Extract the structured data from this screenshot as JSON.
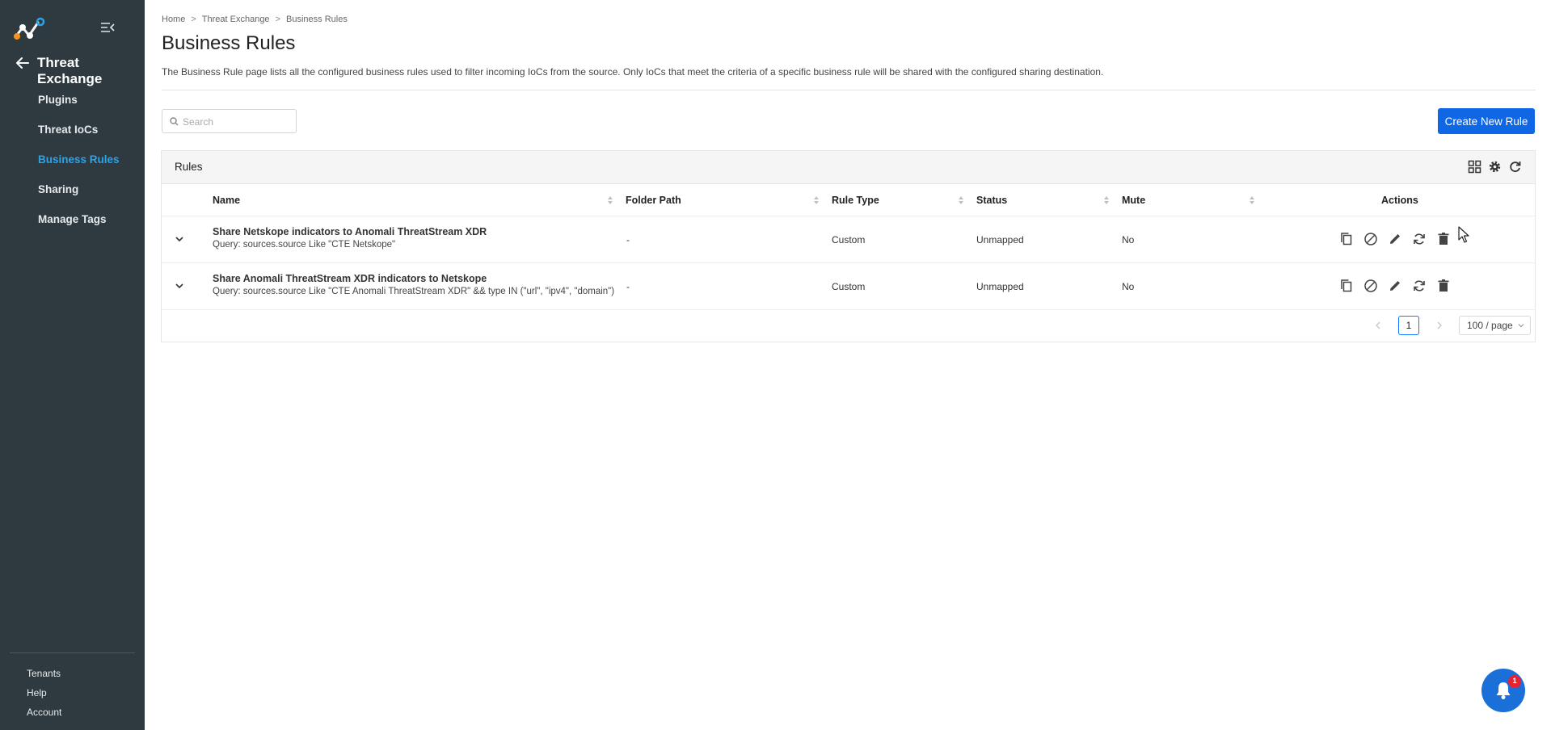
{
  "sidebar": {
    "section_title": "Threat Exchange",
    "items": [
      {
        "label": "Plugins",
        "active": false
      },
      {
        "label": "Threat IoCs",
        "active": false
      },
      {
        "label": "Business Rules",
        "active": true
      },
      {
        "label": "Sharing",
        "active": false
      },
      {
        "label": "Manage Tags",
        "active": false
      }
    ],
    "bottom_items": [
      "Tenants",
      "Help",
      "Account"
    ]
  },
  "breadcrumb": [
    "Home",
    "Threat Exchange",
    "Business Rules"
  ],
  "breadcrumb_separator": ">",
  "page": {
    "title": "Business Rules",
    "description": "The Business Rule page lists all the configured business rules used to filter incoming IoCs from the source. Only IoCs that meet the criteria of a specific business rule will be shared with the configured sharing destination."
  },
  "search": {
    "placeholder": "Search",
    "value": ""
  },
  "create_button": "Create New Rule",
  "card": {
    "title": "Rules"
  },
  "table": {
    "columns": [
      "Name",
      "Folder Path",
      "Rule Type",
      "Status",
      "Mute",
      "Actions"
    ],
    "rows": [
      {
        "name": "Share Netskope indicators to Anomali ThreatStream XDR",
        "query": "Query: sources.source Like \"CTE Netskope\"",
        "folder_path": "-",
        "rule_type": "Custom",
        "status": "Unmapped",
        "mute": "No"
      },
      {
        "name": "Share Anomali ThreatStream XDR indicators to Netskope",
        "query": "Query: sources.source Like \"CTE Anomali ThreatStream XDR\" && type IN (\"url\", \"ipv4\", \"domain\")",
        "folder_path": "-",
        "rule_type": "Custom",
        "status": "Unmapped",
        "mute": "No"
      }
    ]
  },
  "pagination": {
    "current_page": "1",
    "page_size": "100 / page"
  },
  "notifications": {
    "count": "1"
  },
  "colors": {
    "sidebar_bg": "#2f3a40",
    "active_nav": "#2ba3e8",
    "primary_button": "#0f67e6",
    "notification_button": "#1b6fd9",
    "badge": "#e8232f"
  },
  "icons": {
    "header": [
      "grid-icon",
      "gear-icon",
      "refresh-icon"
    ],
    "row_actions": [
      "copy-icon",
      "disable-icon",
      "edit-icon",
      "sync-icon",
      "delete-icon"
    ]
  }
}
